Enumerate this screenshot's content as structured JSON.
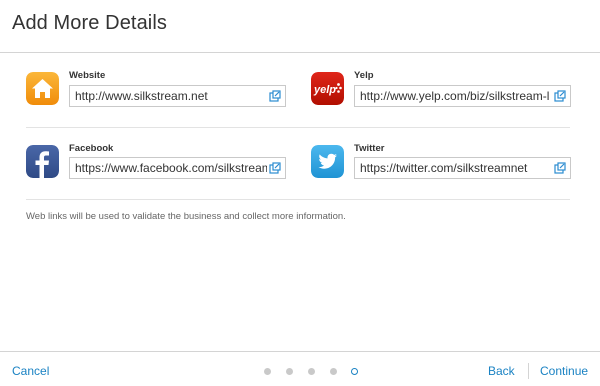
{
  "header": {
    "title": "Add More Details"
  },
  "fields": {
    "website": {
      "label": "Website",
      "value": "http://www.silkstream.net",
      "icon": "home-icon"
    },
    "yelp": {
      "label": "Yelp",
      "value": "http://www.yelp.com/biz/silkstream-l",
      "icon": "yelp-logo-icon"
    },
    "facebook": {
      "label": "Facebook",
      "value": "https://www.facebook.com/silkstream",
      "icon": "facebook-logo-icon"
    },
    "twitter": {
      "label": "Twitter",
      "value": "https://twitter.com/silkstreamnet",
      "icon": "twitter-logo-icon"
    }
  },
  "note": "Web links will be used to validate the business and collect more information.",
  "footer": {
    "cancel_label": "Cancel",
    "back_label": "Back",
    "continue_label": "Continue",
    "steps_total": 5,
    "current_step": 5
  },
  "colors": {
    "website_icon": "#f7a11a",
    "yelp_icon": "#c41200",
    "facebook_icon": "#3b5998",
    "twitter_icon": "#2fa6e3",
    "link": "#1a82c3"
  }
}
